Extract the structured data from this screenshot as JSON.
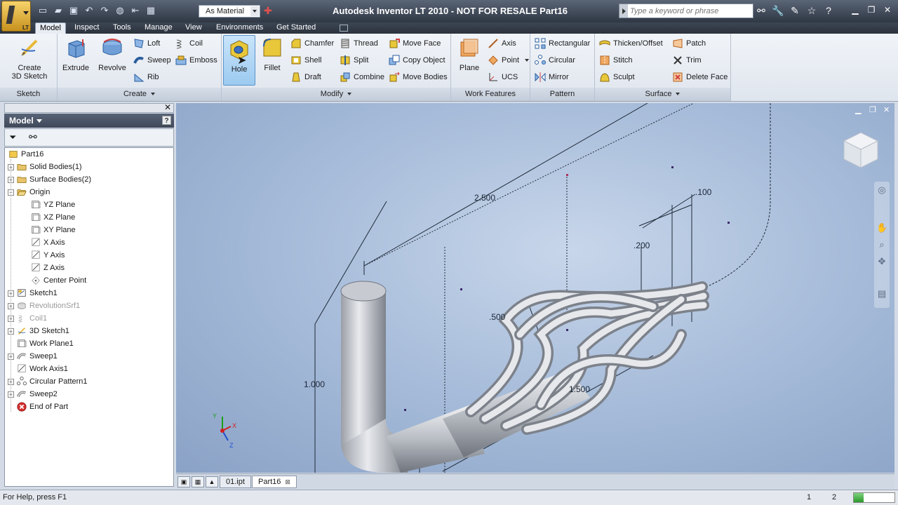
{
  "app": {
    "title": "Autodesk Inventor LT 2010 - NOT FOR RESALE    Part16",
    "app_button_label": "LT",
    "material": "As Material",
    "search_placeholder": "Type a keyword or phrase"
  },
  "tabs": [
    "Model",
    "Inspect",
    "Tools",
    "Manage",
    "View",
    "Environments",
    "Get Started"
  ],
  "active_tab": "Model",
  "ribbon": {
    "sketch": {
      "label": "Sketch",
      "create3d": "Create\n3D Sketch"
    },
    "create": {
      "label": "Create",
      "extrude": "Extrude",
      "revolve": "Revolve",
      "loft": "Loft",
      "sweep": "Sweep",
      "rib": "Rib",
      "coil": "Coil",
      "emboss": "Emboss"
    },
    "modify": {
      "label": "Modify",
      "hole": "Hole",
      "fillet": "Fillet",
      "chamfer": "Chamfer",
      "shell": "Shell",
      "draft": "Draft",
      "thread": "Thread",
      "split": "Split",
      "combine": "Combine",
      "move_face": "Move Face",
      "copy_object": "Copy Object",
      "move_bodies": "Move Bodies"
    },
    "work": {
      "label": "Work Features",
      "plane": "Plane",
      "axis": "Axis",
      "point": "Point",
      "ucs": "UCS"
    },
    "pattern": {
      "label": "Pattern",
      "rectangular": "Rectangular",
      "circular": "Circular",
      "mirror": "Mirror"
    },
    "surface": {
      "label": "Surface",
      "thicken": "Thicken/Offset",
      "stitch": "Stitch",
      "sculpt": "Sculpt",
      "patch": "Patch",
      "trim": "Trim",
      "delete_face": "Delete Face"
    }
  },
  "browser": {
    "title": "Model",
    "help": "?",
    "nodes": [
      {
        "label": "Part16",
        "icon": "part-icon"
      },
      {
        "label": "Solid Bodies(1)",
        "icon": "folder-icon"
      },
      {
        "label": "Surface Bodies(2)",
        "icon": "folder-icon"
      },
      {
        "label": "Origin",
        "icon": "folder-open-icon"
      },
      {
        "label": "YZ Plane",
        "icon": "plane-icon"
      },
      {
        "label": "XZ Plane",
        "icon": "plane-icon"
      },
      {
        "label": "XY Plane",
        "icon": "plane-icon"
      },
      {
        "label": "X Axis",
        "icon": "axis-icon"
      },
      {
        "label": "Y Axis",
        "icon": "axis-icon"
      },
      {
        "label": "Z Axis",
        "icon": "axis-icon"
      },
      {
        "label": "Center Point",
        "icon": "point-icon"
      },
      {
        "label": "Sketch1",
        "icon": "sketch-icon"
      },
      {
        "label": "RevolutionSrf1",
        "icon": "revolve-icon"
      },
      {
        "label": "Coil1",
        "icon": "coil-icon"
      },
      {
        "label": "3D Sketch1",
        "icon": "sketch3d-icon"
      },
      {
        "label": "Work Plane1",
        "icon": "plane-icon"
      },
      {
        "label": "Sweep1",
        "icon": "sweep-icon"
      },
      {
        "label": "Work Axis1",
        "icon": "axis-icon"
      },
      {
        "label": "Circular Pattern1",
        "icon": "pattern-icon"
      },
      {
        "label": "Sweep2",
        "icon": "sweep-icon"
      },
      {
        "label": "End of Part",
        "icon": "end-of-part-icon"
      }
    ]
  },
  "dimensions": [
    "2.500",
    ".100",
    ".200",
    ".500",
    "1.000",
    "1.500"
  ],
  "doc_tabs": [
    "01.ipt",
    "Part16"
  ],
  "active_doc": "Part16",
  "status": {
    "help": "For Help, press F1",
    "count1": "1",
    "count2": "2"
  },
  "colors": {
    "accent": "#9ccaf0",
    "titlebar": "#3c4553"
  }
}
